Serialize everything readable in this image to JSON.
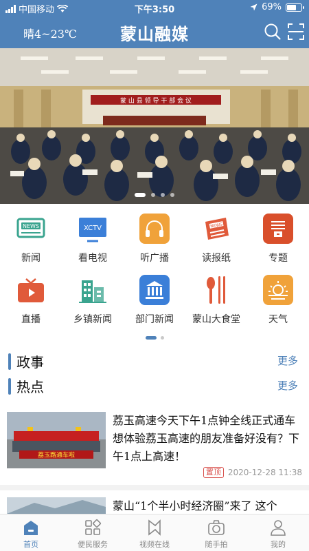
{
  "status": {
    "carrier": "中国移动",
    "time": "下午3:50",
    "battery": "69%",
    "battery_level": 0.69
  },
  "header": {
    "weather": "晴4~23℃",
    "title": "蒙山融媒",
    "search_icon": "search-icon",
    "scan_icon": "scan-icon"
  },
  "banner": {
    "sign_text": "蒙 山 县 领 导 干 部 会 议",
    "slides": 4,
    "active_slide": 0
  },
  "grid": [
    {
      "label": "新闻",
      "icon": "news-icon",
      "color": "#3aa48f"
    },
    {
      "label": "看电视",
      "icon": "tv-icon",
      "color": "#3b7fd8",
      "badge": "XCTV"
    },
    {
      "label": "听广播",
      "icon": "headphones-icon",
      "color": "#f0a23a"
    },
    {
      "label": "读报纸",
      "icon": "newspaper-icon",
      "color": "#e05a3a"
    },
    {
      "label": "专题",
      "icon": "topic-icon",
      "color": "#d94f2b"
    },
    {
      "label": "直播",
      "icon": "live-icon",
      "color": "#e05a3a"
    },
    {
      "label": "乡镇新闻",
      "icon": "buildings-icon",
      "color": "#3aa48f"
    },
    {
      "label": "部门新闻",
      "icon": "institution-icon",
      "color": "#3b7fd8"
    },
    {
      "label": "蒙山大食堂",
      "icon": "cutlery-icon",
      "color": "#e05a3a"
    },
    {
      "label": "天气",
      "icon": "weather-icon",
      "color": "#f0a23a"
    }
  ],
  "pager": {
    "pages": 2,
    "active": 0
  },
  "sections": [
    {
      "title": "政事",
      "more": "更多"
    },
    {
      "title": "热点",
      "more": "更多"
    }
  ],
  "news": [
    {
      "title": "荔玉高速今天下午1点钟全线正式通车 想体验荔玉高速的朋友准备好没有？下午1点上高速！",
      "tag": "置顶",
      "date": "2020-12-28 11:38",
      "thumb_banner": "荔玉路通车啦"
    },
    {
      "title": "蒙山“1个半小时经济圈”来了 这个"
    }
  ],
  "tabs": [
    {
      "label": "首页",
      "icon": "home-icon",
      "active": true
    },
    {
      "label": "便民服务",
      "icon": "services-icon",
      "active": false
    },
    {
      "label": "视频在线",
      "icon": "video-icon",
      "active": false
    },
    {
      "label": "随手拍",
      "icon": "camera-icon",
      "active": false
    },
    {
      "label": "我的",
      "icon": "user-icon",
      "active": false
    }
  ]
}
